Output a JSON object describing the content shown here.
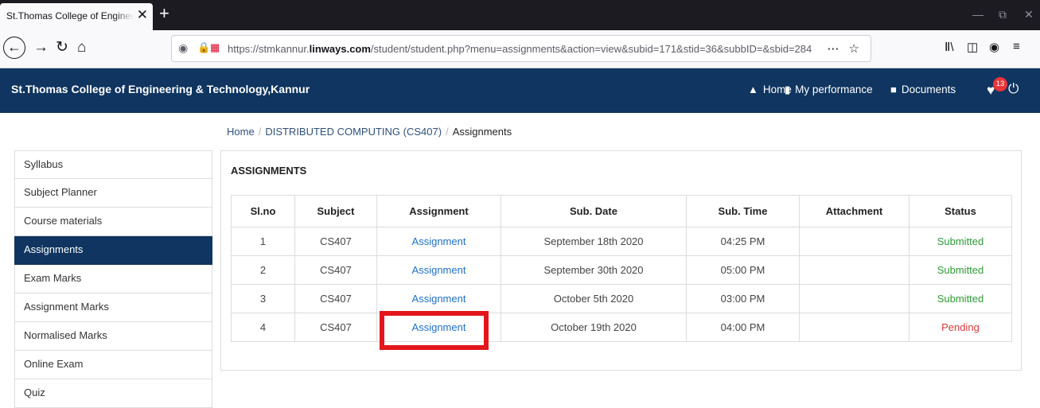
{
  "browser": {
    "tab_title": "St.Thomas College of Engineering &",
    "tab_close": "✕",
    "new_tab": "+",
    "url_prefix": "https://stmkannur.",
    "url_host": "linways.com",
    "url_suffix": "/student/student.php?menu=assignments&action=view&subid=171&stid=36&subbID=&sbid=284",
    "url_actions": "⋯ ☆",
    "icons": [
      "back-icon",
      "forward-icon",
      "reload-icon",
      "home-icon",
      "shield-icon",
      "lock-icon",
      "library-icon",
      "sidebar-icon",
      "account-icon",
      "extensions-icon"
    ]
  },
  "header": {
    "college": "St.Thomas College of Engineering & Technology,Kannur",
    "nav": {
      "home": "Home",
      "performance": "My performance",
      "documents": "Documents"
    },
    "notifications_count": "13",
    "brand_color": "#0f3560"
  },
  "breadcrumb": {
    "home": "Home",
    "subject": "DISTRIBUTED COMPUTING (CS407)",
    "current": "Assignments",
    "separator": "/"
  },
  "sidebar": {
    "items": [
      {
        "label": "Syllabus"
      },
      {
        "label": "Subject Planner"
      },
      {
        "label": "Course materials"
      },
      {
        "label": "Assignments",
        "active": true
      },
      {
        "label": "Exam Marks"
      },
      {
        "label": "Assignment Marks"
      },
      {
        "label": "Normalised Marks"
      },
      {
        "label": "Online Exam"
      },
      {
        "label": "Quiz"
      }
    ]
  },
  "panel": {
    "title": "ASSIGNMENTS",
    "columns": [
      "Sl.no",
      "Subject",
      "Assignment",
      "Sub. Date",
      "Sub. Time",
      "Attachment",
      "Status"
    ],
    "rows": [
      {
        "slno": "1",
        "subject": "CS407",
        "assignment": "Assignment",
        "date": "September 18th 2020",
        "time": "04:25 PM",
        "attachment": "",
        "status": "Submitted"
      },
      {
        "slno": "2",
        "subject": "CS407",
        "assignment": "Assignment",
        "date": "September 30th 2020",
        "time": "05:00 PM",
        "attachment": "",
        "status": "Submitted"
      },
      {
        "slno": "3",
        "subject": "CS407",
        "assignment": "Assignment",
        "date": "October 5th 2020",
        "time": "03:00 PM",
        "attachment": "",
        "status": "Submitted"
      },
      {
        "slno": "4",
        "subject": "CS407",
        "assignment": "Assignment",
        "date": "October 19th 2020",
        "time": "04:00 PM",
        "attachment": "",
        "status": "Pending"
      }
    ],
    "status_colors": {
      "Submitted": "#2e9a35",
      "Pending": "#d93a3a"
    }
  }
}
